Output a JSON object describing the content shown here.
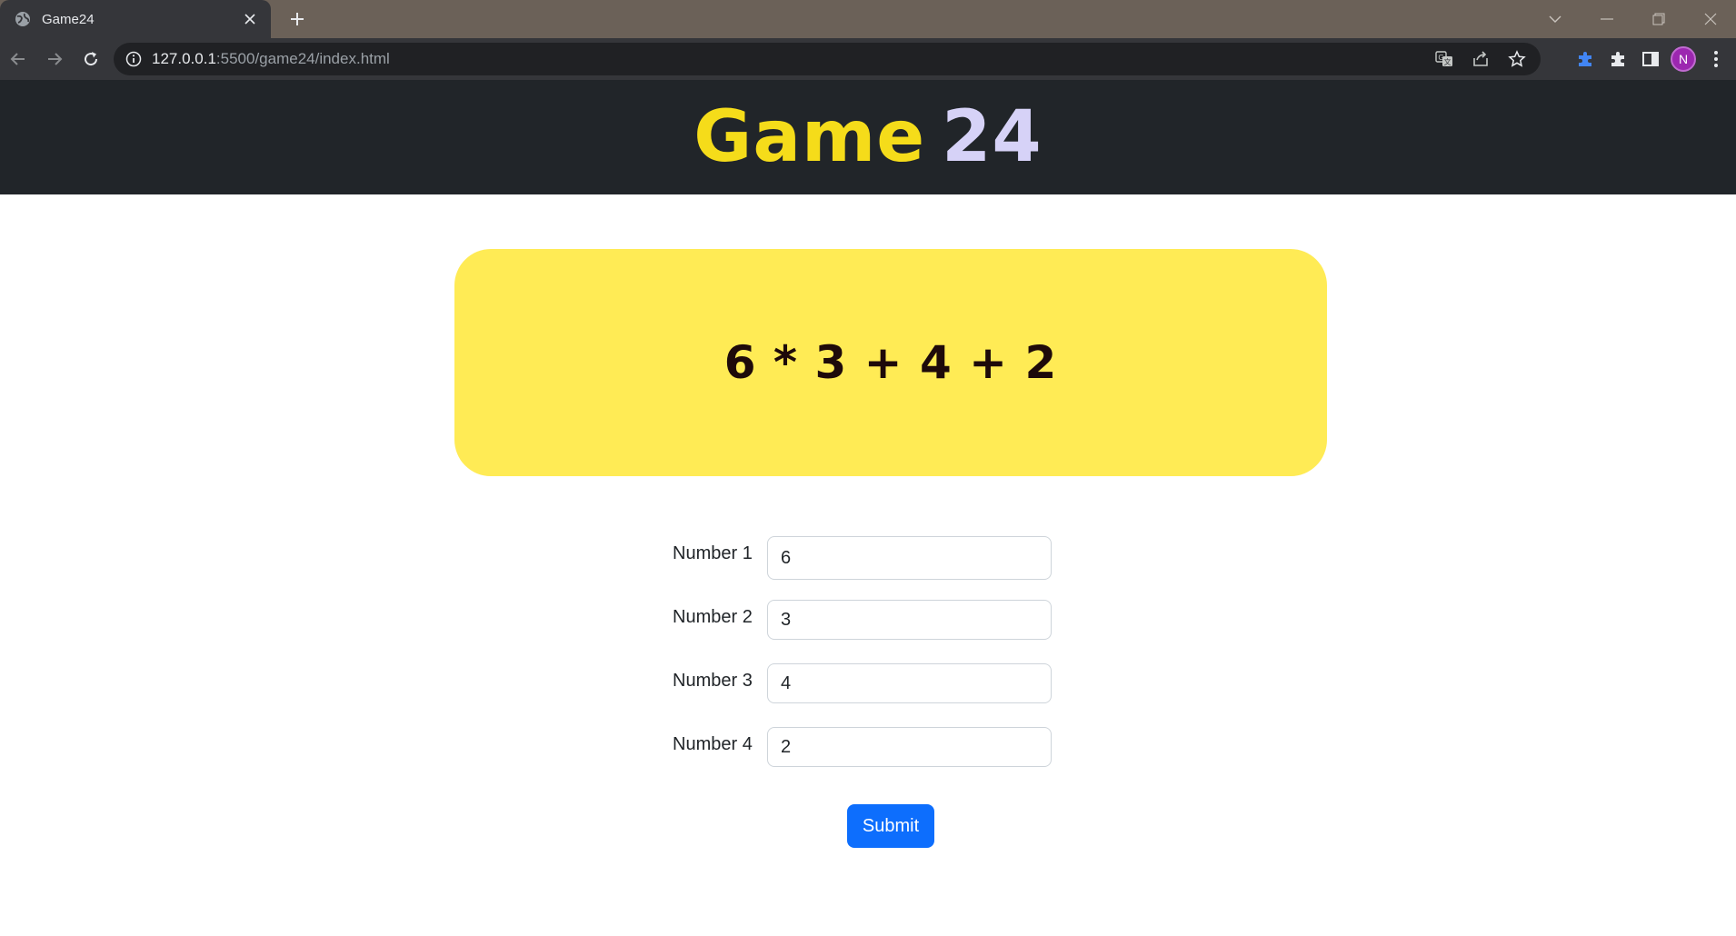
{
  "browser": {
    "tab_title": "Game24",
    "url_host": "127.0.0.1",
    "url_rest": ":5500/game24/index.html",
    "avatar_initial": "N"
  },
  "header": {
    "title_word1": "Game",
    "title_word2": "24",
    "colors": {
      "word1": "#f5dc1a",
      "word2": "#d6d2f7",
      "background": "#212529"
    }
  },
  "solution": {
    "expression": "6 * 3 + 4 + 2",
    "background": "#ffeb55"
  },
  "form": {
    "fields": [
      {
        "label": "Number 1",
        "value": "6"
      },
      {
        "label": "Number 2",
        "value": "3"
      },
      {
        "label": "Number 3",
        "value": "4"
      },
      {
        "label": "Number 4",
        "value": "2"
      }
    ],
    "submit_label": "Submit",
    "submit_color": "#0d6efd"
  },
  "icons": [
    "globe-icon",
    "close-icon",
    "plus-icon",
    "back-arrow-icon",
    "forward-arrow-icon",
    "reload-icon",
    "info-icon",
    "translate-icon",
    "share-icon",
    "star-icon",
    "extension-icon",
    "puzzle-icon",
    "sidepanel-icon",
    "kebab-menu-icon",
    "chevron-down-icon",
    "minimize-icon",
    "restore-icon",
    "window-close-icon"
  ]
}
